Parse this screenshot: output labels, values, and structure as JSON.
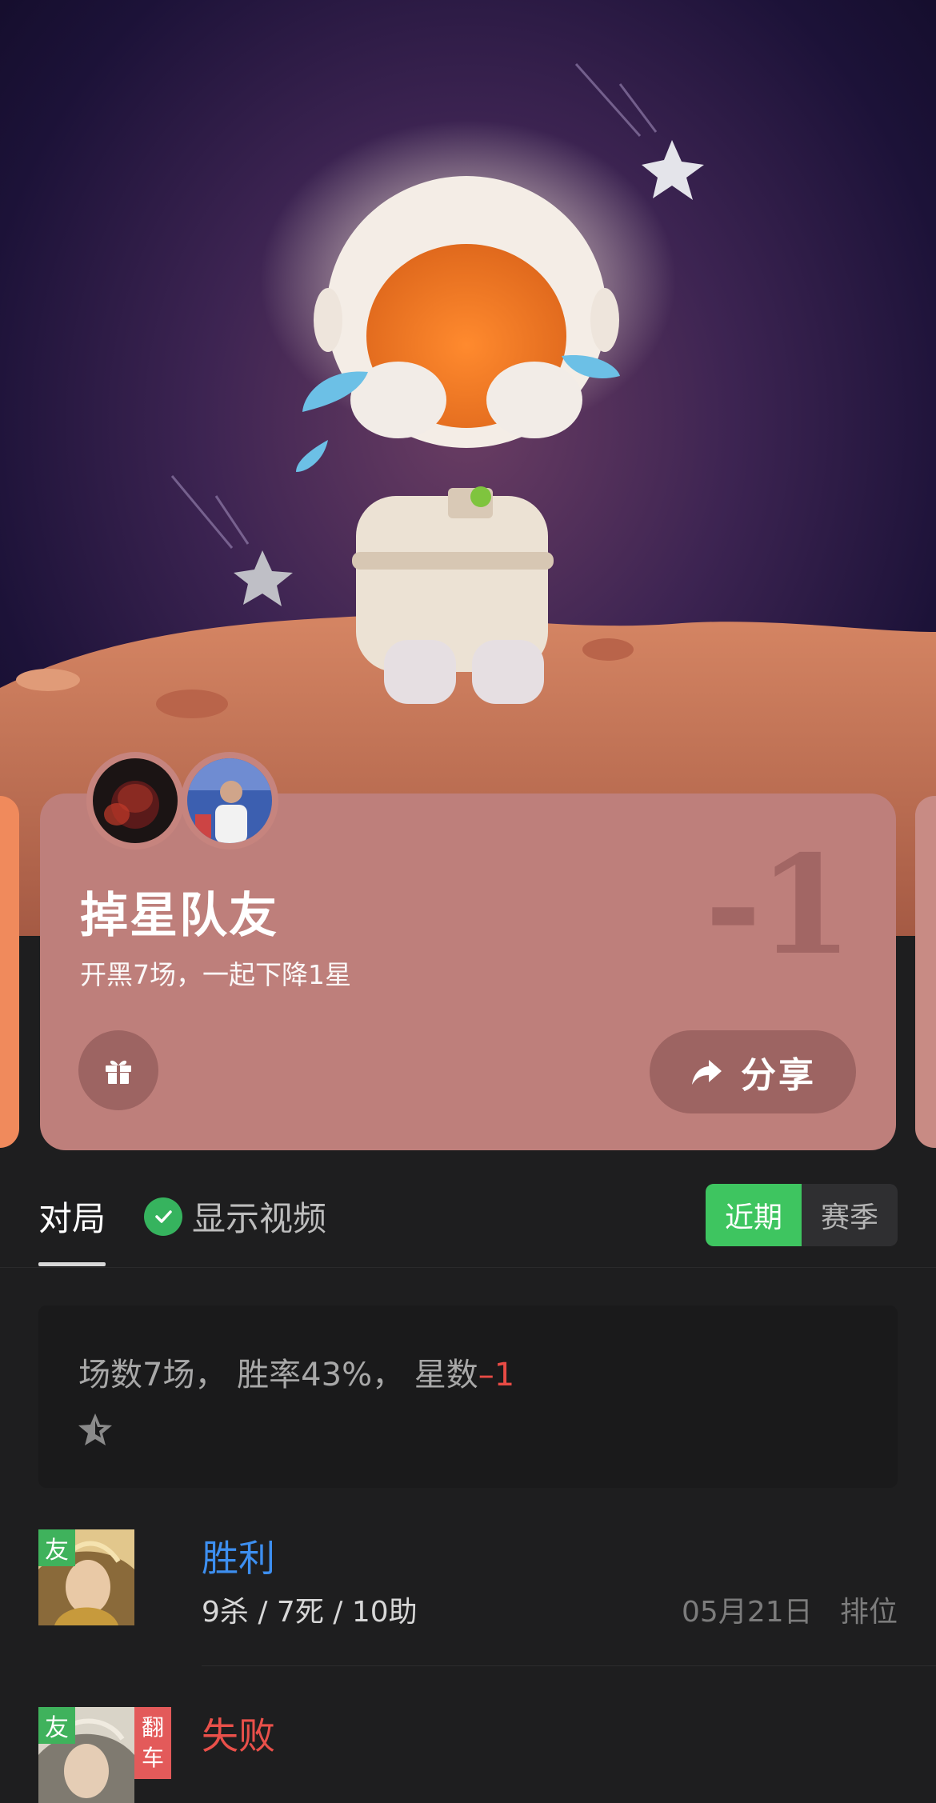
{
  "card": {
    "title": "掉星队友",
    "subtitle": "开黑7场，一起下降1星",
    "big_number": "-1",
    "share_label": "分享",
    "gift_icon": "gift-icon",
    "share_icon": "share-arrow-icon"
  },
  "tabs": {
    "active_label": "对局",
    "video_label": "显示视频",
    "recent_label": "近期",
    "season_label": "赛季"
  },
  "summary": {
    "matches_text": "场数7场，",
    "winrate_text": "胜率43%，",
    "stars_label": "星数",
    "stars_value": "–1"
  },
  "matches": [
    {
      "badge": "友",
      "result": "胜利",
      "kda": "9杀 / 7死 / 10助",
      "date": "05月21日",
      "mode": "排位"
    },
    {
      "badge": "友",
      "flip_badge_1": "翻",
      "flip_badge_2": "车",
      "result": "失败"
    }
  ],
  "colors": {
    "card": "#be7f7b",
    "win": "#3d8ff0",
    "lose": "#e9504a",
    "accent_green": "#3ec560"
  }
}
